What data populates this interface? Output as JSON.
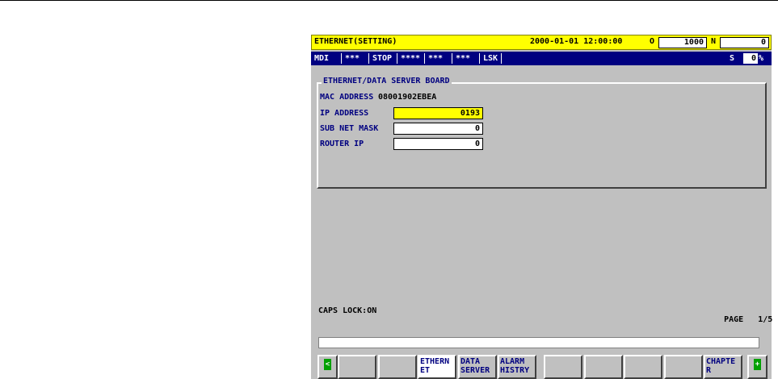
{
  "title": {
    "screen_name": "ETHERNET(SETTING)",
    "datetime": "2000-01-01 12:00:00",
    "o_label": "O",
    "o_value": "1000",
    "n_label": "N",
    "n_value": "0"
  },
  "status": {
    "mode": "MDI",
    "s1": "***",
    "state": "STOP",
    "s2": "****",
    "s3": "***",
    "s4": "***",
    "lsk": "LSK",
    "s_label": "S",
    "s_value": "0",
    "percent": "%"
  },
  "panel": {
    "title": "ETHERNET/DATA SERVER BOARD",
    "mac_label": "MAC ADDRESS",
    "mac_value": "08001902EBEA",
    "ip_label": "IP ADDRESS",
    "ip_value": "0193",
    "subnet_label": "SUB NET MASK",
    "subnet_value": "0",
    "router_label": "ROUTER IP",
    "router_value": "0"
  },
  "footer": {
    "caps": "CAPS LOCK:ON",
    "page_label": "PAGE",
    "page_value": "1/5"
  },
  "softkeys": [
    {
      "label": "",
      "icon": "left-arrow-icon"
    },
    {
      "label": ""
    },
    {
      "label": ""
    },
    {
      "label": "ETHERN ET"
    },
    {
      "label": "DATA SERVER"
    },
    {
      "label": "ALARM HISTRY"
    },
    {
      "label": ""
    },
    {
      "label": ""
    },
    {
      "label": ""
    },
    {
      "label": ""
    },
    {
      "label": "CHAPTE R"
    },
    {
      "label": "",
      "icon": "plus-icon"
    }
  ],
  "colors": {
    "title_bg": "#ffff00",
    "status_bg": "#000080",
    "screen_bg": "#c0c0c0",
    "label_text": "#000080"
  }
}
